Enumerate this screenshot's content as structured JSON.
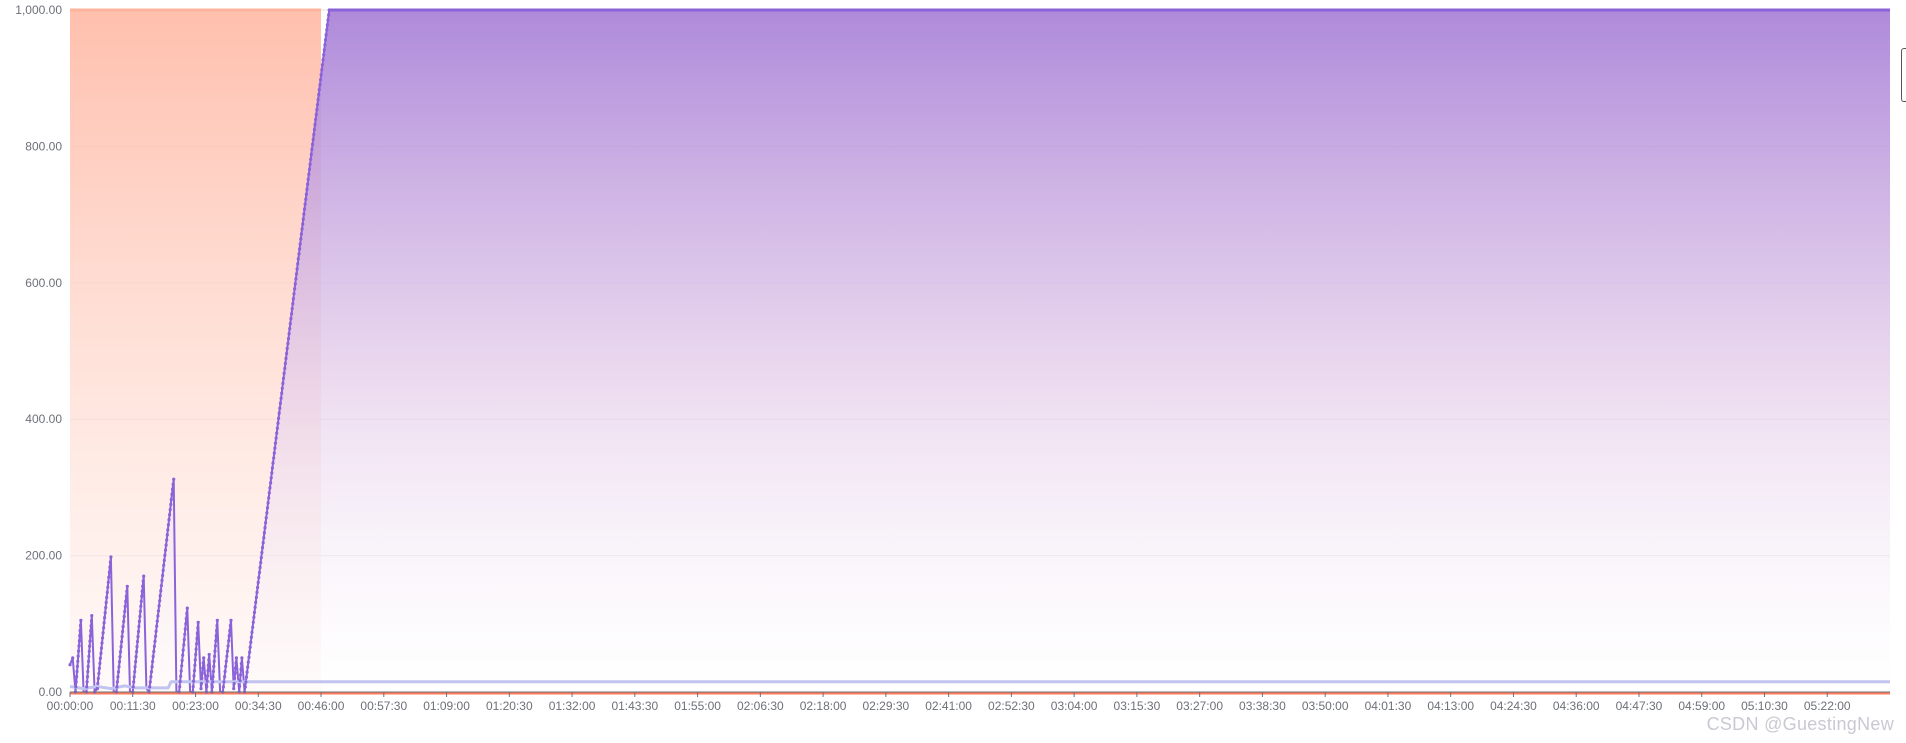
{
  "chart_data": {
    "type": "area",
    "title": "",
    "xlabel": "",
    "ylabel": "",
    "ylim": [
      0,
      1000
    ],
    "yticks": [
      0,
      200,
      400,
      600,
      800,
      1000
    ],
    "ytick_labels": [
      "0.00",
      "200.00",
      "400.00",
      "600.00",
      "800.00",
      "1,000.00"
    ],
    "xlim_seconds": [
      0,
      20010
    ],
    "xtick_labels": [
      "00:00:00",
      "00:11:30",
      "00:23:00",
      "00:34:30",
      "00:46:00",
      "00:57:30",
      "01:09:00",
      "01:20:30",
      "01:32:00",
      "01:43:30",
      "01:55:00",
      "02:06:30",
      "02:18:00",
      "02:29:30",
      "02:41:00",
      "02:52:30",
      "03:04:00",
      "03:15:30",
      "03:27:00",
      "03:38:30",
      "03:50:00",
      "04:01:30",
      "04:13:00",
      "04:24:30",
      "04:36:00",
      "04:47:30",
      "04:59:00",
      "05:10:30",
      "05:22:00"
    ],
    "grid": true,
    "legend": "none",
    "series": [
      {
        "color": "#ff7f5f",
        "note_fill": "area",
        "x": [
          "00:00:00",
          "00:00:30",
          "00:46:00",
          "05:33:30"
        ],
        "y": [
          1000,
          1000,
          1000,
          1000
        ],
        "baseline_y": [
          0,
          0,
          0,
          0
        ]
      },
      {
        "color": "#8b63d9",
        "x": [
          "00:00:00",
          "00:00:30",
          "00:01:00",
          "00:02:00",
          "00:02:30",
          "00:03:00",
          "00:04:00",
          "00:04:30",
          "00:05:00",
          "00:07:30",
          "00:08:00",
          "00:08:30",
          "00:10:30",
          "00:11:00",
          "00:11:30",
          "00:13:30",
          "00:14:00",
          "00:14:30",
          "00:19:00",
          "00:19:30",
          "00:20:00",
          "00:21:30",
          "00:22:00",
          "00:22:30",
          "00:23:30",
          "00:24:00",
          "00:24:30",
          "00:25:00",
          "00:25:30",
          "00:26:00",
          "00:27:00",
          "00:27:30",
          "00:28:00",
          "00:29:30",
          "00:30:00",
          "00:30:30",
          "00:31:00",
          "00:31:30",
          "00:32:00",
          "00:47:30",
          "05:33:30"
        ],
        "y": [
          40,
          50,
          0,
          105,
          0,
          0,
          112,
          0,
          5,
          198,
          0,
          0,
          155,
          0,
          0,
          170,
          5,
          0,
          312,
          0,
          0,
          123,
          0,
          0,
          102,
          5,
          50,
          0,
          55,
          0,
          105,
          0,
          0,
          105,
          5,
          50,
          0,
          50,
          0,
          1000,
          1000
        ]
      },
      {
        "color": "#c2c4f0",
        "x": [
          "00:00:00",
          "00:02:30",
          "00:05:00",
          "00:07:30",
          "00:10:00",
          "00:12:00",
          "00:18:00",
          "00:18:30",
          "00:32:00",
          "00:33:00",
          "05:33:30"
        ],
        "y": [
          8,
          5,
          8,
          5,
          9,
          6,
          6,
          15,
          15,
          15,
          15
        ]
      },
      {
        "color": "#ff7a5a",
        "x": [
          "00:00:00",
          "05:33:30"
        ],
        "y": [
          0,
          0
        ]
      }
    ]
  },
  "watermark": "CSDN @GuestingNew"
}
